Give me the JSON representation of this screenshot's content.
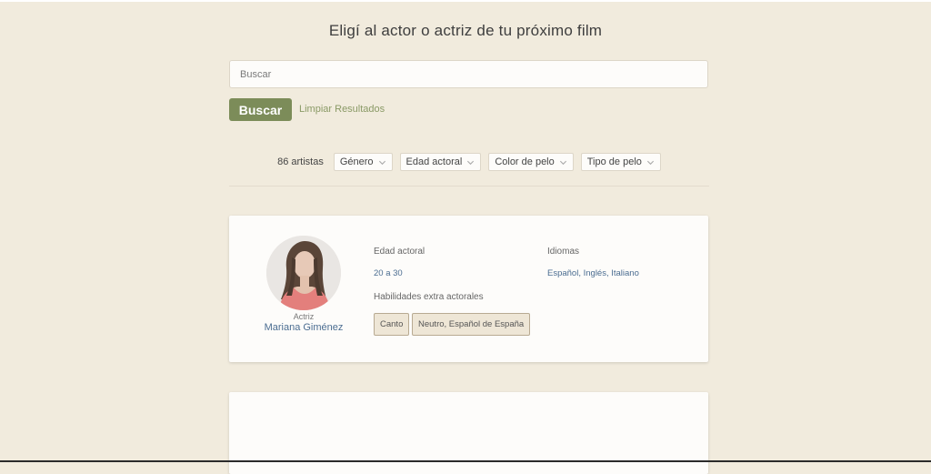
{
  "header": {
    "title": "Eligí al actor o actriz de tu próximo film"
  },
  "search": {
    "placeholder": "Buscar",
    "value": "",
    "button_label": "Buscar",
    "clear_label": "Limpiar Resultados"
  },
  "filters": {
    "count_label": "86 artistas",
    "items": [
      {
        "label": "Género"
      },
      {
        "label": "Edad actoral"
      },
      {
        "label": "Color de pelo"
      },
      {
        "label": "Tipo de pelo"
      }
    ]
  },
  "artists": [
    {
      "role": "Actriz",
      "name": "Mariana Giménez",
      "age_label": "Edad actoral",
      "age_value": "20 a 30",
      "languages_label": "Idiomas",
      "languages_value": "Español, Inglés, Italiano",
      "skills_label": "Habilidades extra actorales",
      "skills": [
        "Canto",
        "Neutro, Español de España"
      ]
    }
  ],
  "colors": {
    "background": "#f1ebdd",
    "accent": "#7c8c59",
    "link": "#4b6d91",
    "tag_border": "#b8aa92"
  },
  "icons": {
    "dropdown": "chevron-down-icon"
  }
}
